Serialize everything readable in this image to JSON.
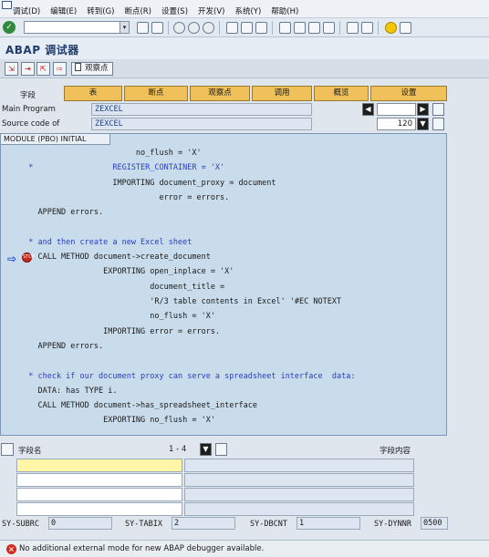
{
  "menu": [
    "调试(D)",
    "编辑(E)",
    "转到(G)",
    "断点(R)",
    "设置(S)",
    "开发(V)",
    "系统(Y)",
    "帮助(H)"
  ],
  "title": "ABAP 调试器",
  "app_toolbar": {
    "watchpoint_label": "观察点"
  },
  "tabs": {
    "field_label": "字段",
    "items": [
      "表",
      "断点",
      "观察点",
      "调用",
      "概览",
      "设置"
    ]
  },
  "program": {
    "main_label": "Main Program",
    "main_value": "ZEXCEL",
    "source_label": "Source code of",
    "source_value": "ZEXCEL",
    "line_number": "120"
  },
  "code_panel": {
    "header": "MODULE (PBO) INITIAL",
    "lines": [
      "                         no_flush = 'X'",
      "  *                 REGISTER_CONTAINER = 'X'",
      "                    IMPORTING document_proxy = document",
      "                              error = errors.",
      "    APPEND errors.",
      "",
      "  * and then create a new Excel sheet",
      "    CALL METHOD document->create_document",
      "                  EXPORTING open_inplace = 'X'",
      "                            document_title =",
      "                            'R/3 table contents in Excel' '#EC NOTEXT",
      "                            no_flush = 'X'",
      "                  IMPORTING error = errors.",
      "    APPEND errors.",
      "",
      "  * check if our document proxy can serve a spreadsheet interface  data:",
      "    DATA: has TYPE i.",
      "    CALL METHOD document->has_spreadsheet_interface",
      "                  EXPORTING no_flush = 'X'"
    ]
  },
  "variables": {
    "name_header": "字段名",
    "range": "1 - 4",
    "value_header": "字段内容",
    "rows": [
      "",
      "",
      "",
      ""
    ]
  },
  "system_fields": [
    {
      "name": "SY-SUBRC",
      "value": "0"
    },
    {
      "name": "SY-TABIX",
      "value": "2"
    },
    {
      "name": "SY-DBCNT",
      "value": "1"
    },
    {
      "name": "SY-DYNNR",
      "value": "0500"
    }
  ],
  "status": {
    "message": "No additional external mode for new ABAP debugger available."
  },
  "colors": {
    "tab": "#f0c15a",
    "code_bg": "#c9dcec",
    "comment": "#2a3ec0",
    "title": "#1f3c6b"
  }
}
